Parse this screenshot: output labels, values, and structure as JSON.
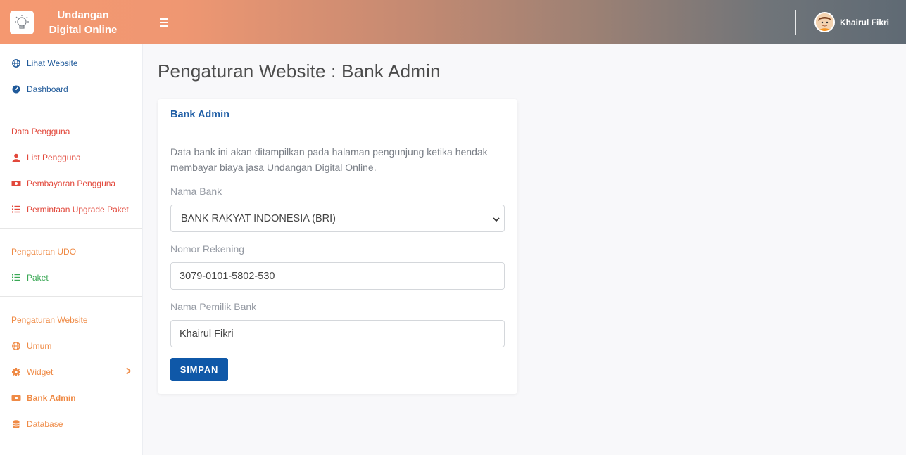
{
  "header": {
    "brand_line1": "Undangan",
    "brand_line2": "Digital Online",
    "user_name": "Khairul Fikri"
  },
  "sidebar": {
    "top_items": [
      {
        "label": "Lihat Website",
        "icon": "globe-icon"
      },
      {
        "label": "Dashboard",
        "icon": "tachometer-icon"
      }
    ],
    "sections": [
      {
        "heading": "Data Pengguna",
        "items": [
          {
            "label": "List Pengguna",
            "icon": "user-icon"
          },
          {
            "label": "Pembayaran Pengguna",
            "icon": "money-bill-icon"
          },
          {
            "label": "Permintaan Upgrade Paket",
            "icon": "list-icon"
          }
        ]
      },
      {
        "heading": "Pengaturan UDO",
        "items": [
          {
            "label": "Paket",
            "icon": "list-icon"
          }
        ]
      },
      {
        "heading": "Pengaturan Website",
        "items": [
          {
            "label": "Umum",
            "icon": "globe-icon"
          },
          {
            "label": "Widget",
            "icon": "cog-icon"
          },
          {
            "label": "Bank Admin",
            "icon": "money-bill-icon",
            "active": true
          },
          {
            "label": "Database",
            "icon": "database-icon"
          }
        ]
      }
    ]
  },
  "main": {
    "page_title": "Pengaturan Website : Bank Admin",
    "card": {
      "title": "Bank Admin",
      "description": "Data bank ini akan ditampilkan pada halaman pengunjung ketika hendak membayar biaya jasa Undangan Digital Online.",
      "bank_label": "Nama Bank",
      "bank_value": "BANK RAKYAT INDONESIA (BRI)",
      "account_label": "Nomor Rekening",
      "account_value": "3079-0101-5802-530",
      "owner_label": "Nama Pemilik Bank",
      "owner_value": "Khairul Fikri",
      "save_label": "SIMPAN"
    }
  },
  "colors": {
    "primary": "#0f58a8",
    "sidebar_blue": "#205a9a",
    "sidebar_red": "#e2483b",
    "sidebar_orange": "#ef8a45",
    "sidebar_green": "#3aa855"
  }
}
